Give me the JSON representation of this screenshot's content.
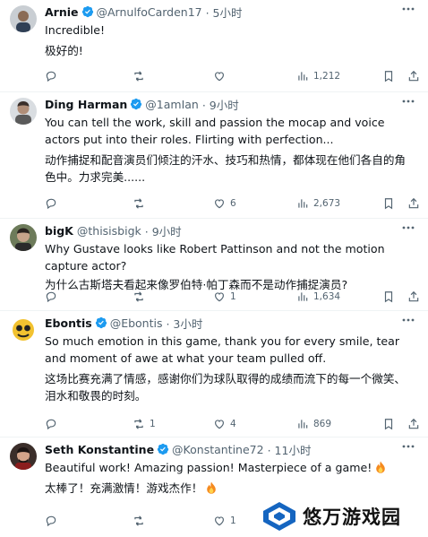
{
  "tweets": [
    {
      "name": "Arnie",
      "handle": "@ArnulfoCarden17",
      "time": "· 5小时",
      "lines": [
        "Incredible!",
        "极好的!"
      ],
      "replies": "",
      "retweets": "",
      "likes": "",
      "views": "1,212"
    },
    {
      "name": "Ding Harman",
      "handle": "@1amIan",
      "time": "· 9小时",
      "lines": [
        "You can tell the work, skill and passion the mocap and voice actors put into their roles. Flirting with perfection...",
        "动作捕捉和配音演员们倾注的汗水、技巧和热情，都体现在他们各自的角色中。力求完美......"
      ],
      "replies": "",
      "retweets": "",
      "likes": "6",
      "views": "2,673"
    },
    {
      "name": "bigK",
      "handle": "@thisisbigk",
      "time": "· 9小时",
      "lines": [
        "Why Gustave looks like Robert Pattinson and not the motion capture actor?",
        "为什么古斯塔夫看起来像罗伯特·帕丁森而不是动作捕捉演员?"
      ],
      "replies": "",
      "retweets": "",
      "likes": "1",
      "views": "1,634"
    },
    {
      "name": "Ebontis",
      "handle": "@Ebontis",
      "time": "· 3小时",
      "lines": [
        "So much emotion in this game, thank you for every smile, tear and moment of awe at what your team pulled off.",
        "这场比赛充满了情感，感谢你们为球队取得的成绩而流下的每一个微笑、泪水和敬畏的时刻。"
      ],
      "replies": "",
      "retweets": "1",
      "likes": "4",
      "views": "869"
    },
    {
      "name": "Seth Konstantine",
      "handle": "@Konstantine72",
      "time": "· 11小时",
      "lines": [
        "Beautiful work! Amazing passion! Masterpiece of a game!",
        "太棒了！充满激情！游戏杰作！"
      ],
      "replies": "",
      "retweets": "",
      "likes": "1",
      "views": ""
    }
  ],
  "watermark": {
    "text": "悠万游戏园"
  },
  "colors": {
    "verified": "#1d9bf0",
    "meta": "#536471",
    "divider": "#eff3f4"
  }
}
